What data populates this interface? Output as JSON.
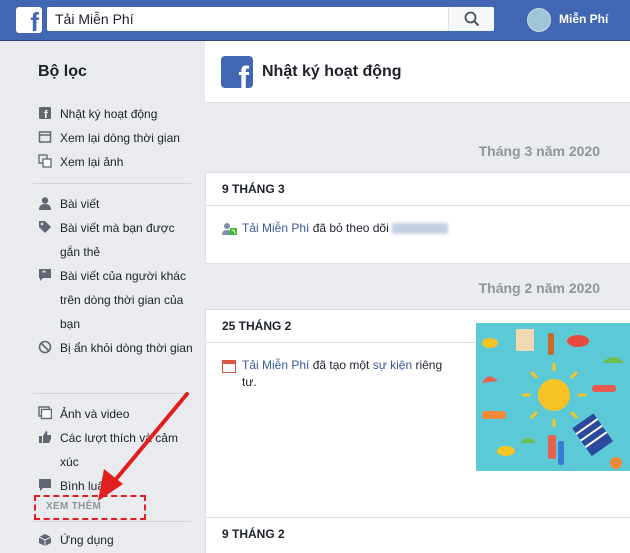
{
  "topbar": {
    "logo_letter": "f",
    "search_value": "Tải Miễn Phí",
    "profile_name": "Miễn Phí"
  },
  "sidebar": {
    "title": "Bộ lọc",
    "group1": [
      "Nhật ký hoạt động",
      "Xem lại dòng thời gian",
      "Xem lại ảnh"
    ],
    "group2": [
      "Bài viết",
      "Bài viết mà bạn được gắn thẻ",
      "Bài viết của người khác trên dòng thời gian của bạn",
      "Bị ẩn khỏi dòng thời gian"
    ],
    "group3": [
      "Ảnh và video",
      "Các lượt thích và cảm xúc",
      "Bình luận"
    ],
    "see_more": "XEM THÊM",
    "apps": "Ứng dụng"
  },
  "main": {
    "header_title": "Nhật ký hoạt động",
    "months": [
      "Tháng 3 năm 2020",
      "Tháng 2 năm 2020"
    ],
    "days": [
      "9 THÁNG 3",
      "25 THÁNG 2",
      "9 THÁNG 2"
    ],
    "activity1": {
      "name": "Tải Miễn Phí",
      "text": " đã bỏ theo dõi "
    },
    "activity2": {
      "name": "Tải Miễn Phí",
      "text1": " đã tạo một ",
      "link": "sự kiện",
      "text2": " riêng tư."
    }
  },
  "colors": {
    "brand": "#4267b2",
    "link": "#385898",
    "annotation": "#e02020"
  }
}
